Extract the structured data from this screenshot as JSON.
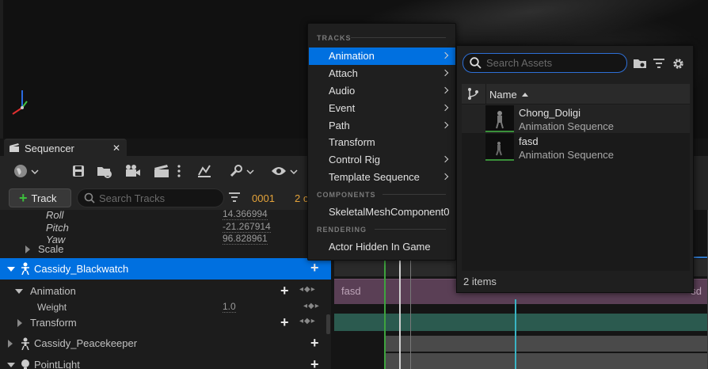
{
  "sequencer": {
    "tab_title": "Sequencer",
    "close_glyph": "✕",
    "add_track_label": "Track",
    "search_tracks_placeholder": "Search Tracks",
    "frame_current": "0001",
    "frame_other": "2 c"
  },
  "tree": {
    "rows": [
      {
        "label": "Roll",
        "value": "14.366994"
      },
      {
        "label": "Pitch",
        "value": "-21.267914"
      },
      {
        "label": "Yaw",
        "value": "96.828961"
      },
      {
        "label": "Scale"
      },
      {
        "label": "Cassidy_Blackwatch"
      },
      {
        "label": "Animation"
      },
      {
        "label": "Weight",
        "value": "1.0"
      },
      {
        "label": "Transform"
      },
      {
        "label": "Cassidy_Peacekeeper"
      },
      {
        "label": "PointLight"
      }
    ]
  },
  "timeline": {
    "section_label": "fasd",
    "section_label_end": "sd"
  },
  "menu": {
    "header_tracks": "TRACKS",
    "header_components": "COMPONENTS",
    "header_rendering": "RENDERING",
    "items": [
      {
        "label": "Animation",
        "submenu": true
      },
      {
        "label": "Attach",
        "submenu": true
      },
      {
        "label": "Audio",
        "submenu": true
      },
      {
        "label": "Event",
        "submenu": true
      },
      {
        "label": "Path",
        "submenu": true
      },
      {
        "label": "Transform",
        "submenu": false
      },
      {
        "label": "Control Rig",
        "submenu": true
      },
      {
        "label": "Template Sequence",
        "submenu": true
      }
    ],
    "component_items": [
      {
        "label": "SkeletalMeshComponent0"
      }
    ],
    "rendering_items": [
      {
        "label": "Actor Hidden In Game"
      }
    ]
  },
  "asset_picker": {
    "search_placeholder": "Search Assets",
    "column_name": "Name",
    "assets": [
      {
        "name": "Chong_Doligi",
        "type": "Animation Sequence"
      },
      {
        "name": "fasd",
        "type": "Animation Sequence"
      }
    ],
    "item_count": "2 items"
  },
  "colors": {
    "accent": "#0070e0",
    "frame_number": "#e4a33a",
    "add_green": "#3cbe3c",
    "animation_section": "#5a3f55",
    "transform_section": "#2b5a4f"
  },
  "icons": [
    "search-icon",
    "filter-icon",
    "gear-icon",
    "folder-icon",
    "save-icon",
    "camera-icon",
    "clapper-icon",
    "wrench-icon",
    "eye-icon",
    "skeleton-icon",
    "light-icon"
  ]
}
